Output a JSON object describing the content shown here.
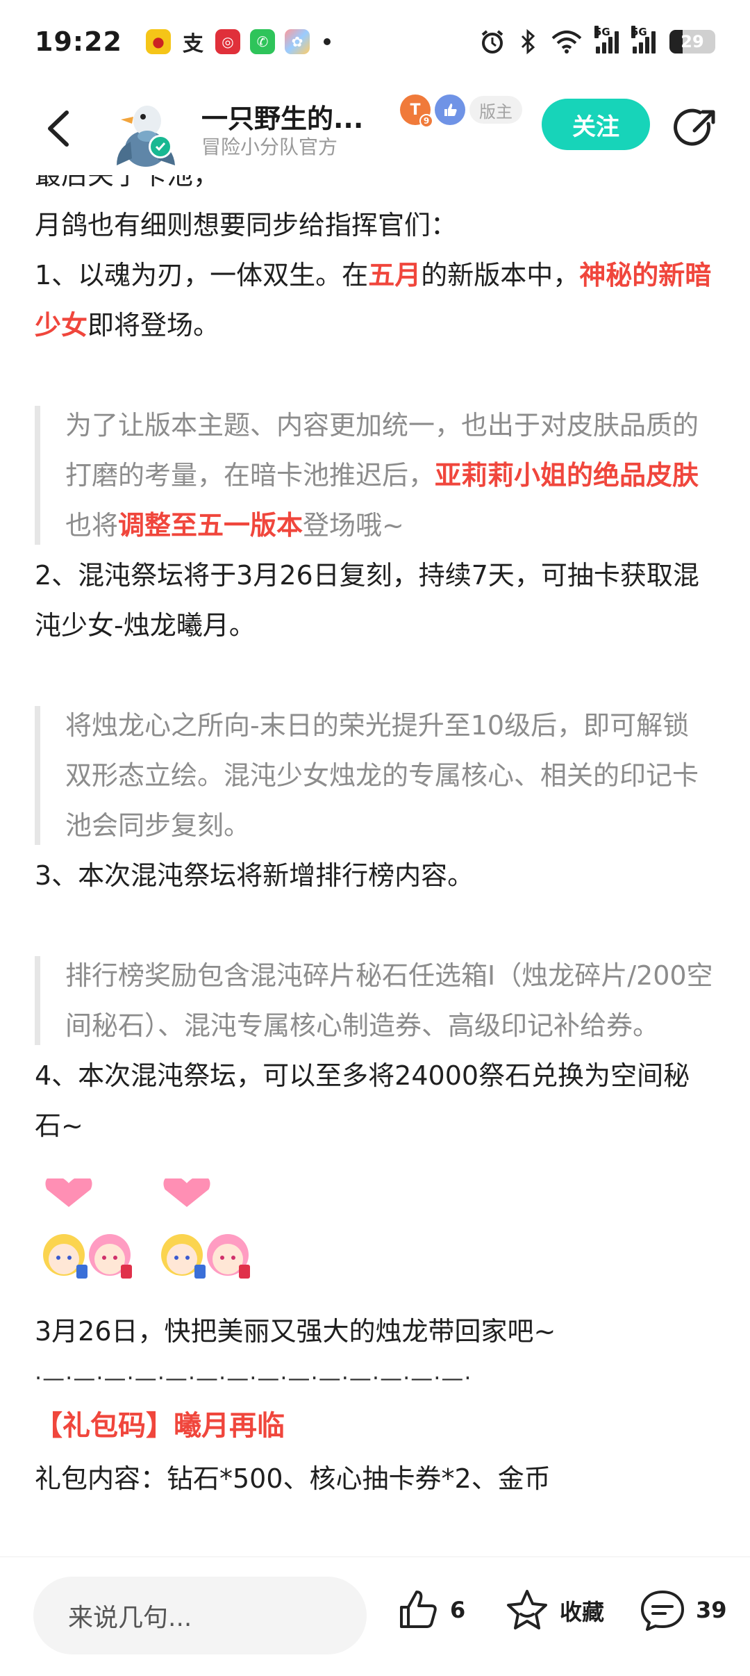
{
  "status": {
    "time": "19:22",
    "net1": "5G",
    "net2": "5G",
    "battery": "29",
    "battery_level": 0.29
  },
  "header": {
    "name": "一只野生的...",
    "subtitle": "冒险小分队官方",
    "role_badge": "版主",
    "follow_label": "关注"
  },
  "post": {
    "top_partial": "最后关了卡池，",
    "intro": "月鸽也有细则想要同步给指挥官们：",
    "item1": {
      "a": "1、以魂为刃，一体双生。在",
      "b": "五月",
      "c": "的新版本中，",
      "d": "神秘的新暗少女",
      "e": "即将登场。"
    },
    "quote1": {
      "a": "为了让版本主题、内容更加统一，也出于对皮肤品质的打磨的考量，在暗卡池推迟后，",
      "b": "亚莉莉小姐的绝品皮肤",
      "c": "也将",
      "d": "调整至五一版本",
      "e": "登场哦~"
    },
    "item2": "2、混沌祭坛将于3月26日复刻，持续7天，可抽卡获取混沌少女-烛龙曦月。",
    "quote2": "将烛龙心之所向-末日的荣光提升至10级后，即可解锁双形态立绘。混沌少女烛龙的专属核心、相关的印记卡池会同步复刻。",
    "item3": "3、本次混沌祭坛将新增排行榜内容。",
    "quote3": "排行榜奖励包含混沌碎片秘石任选箱I（烛龙碎片/200空间秘石）、混沌专属核心制造券、高级印记补给券。",
    "item4": "4、本次混沌祭坛，可以至多将24000祭石兑换为空间秘石~",
    "closing": "3月26日，快把美丽又强大的烛龙带回家吧~",
    "divider": "·—·—·—·—·—·—·—·—·—·—·—·—·—·—·",
    "gift_title": "【礼包码】曦月再临",
    "gift_content_partial": "礼包内容：钻石*500、核心抽卡券*2、金币"
  },
  "bottom": {
    "comment_placeholder": "来说几句...",
    "like_count": "6",
    "collect_label": "收藏",
    "comment_count": "39"
  }
}
